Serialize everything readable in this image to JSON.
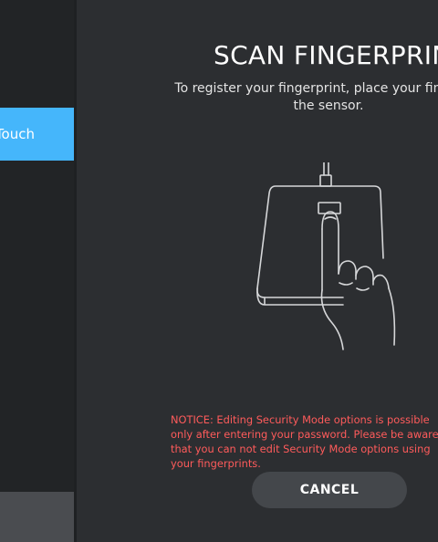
{
  "sidebar": {
    "active_item_label": "Touch"
  },
  "dialog": {
    "title": "SCAN FINGERPRINT",
    "subtitle": "To register your fingerprint, place your finger on the sensor.",
    "illustration_icon": "finger-on-sensor-icon",
    "notice": "NOTICE: Editing Security Mode options is possible only after entering your password. Please be aware that you can not edit Security Mode options using your fingerprints.",
    "cancel_label": "CANCEL"
  },
  "colors": {
    "accent": "#45b6fb",
    "notice": "#ff5b5b",
    "background": "#2c2e31",
    "sidebar": "#222426"
  }
}
